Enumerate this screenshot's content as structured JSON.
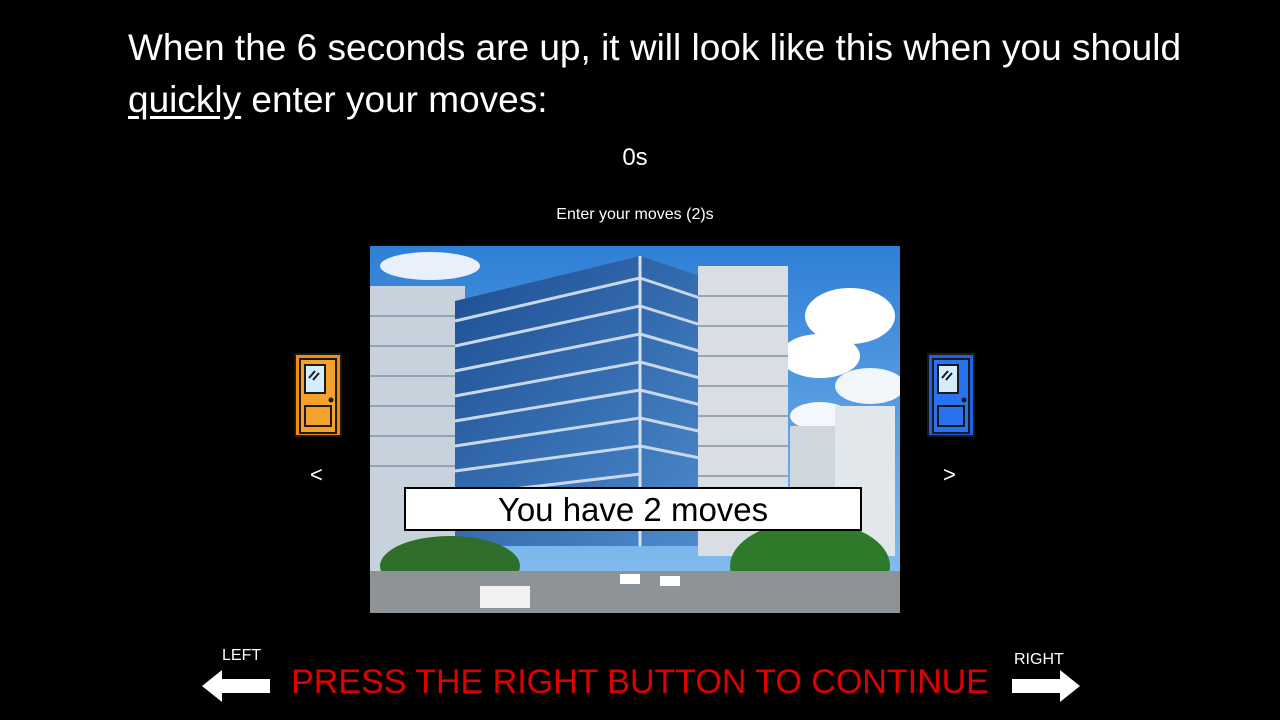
{
  "instruction": {
    "before": "When the 6 seconds are up, it will look like this when you should ",
    "emphasis": "quickly",
    "after": " enter your moves:"
  },
  "timer": "0s",
  "prompt": "Enter your moves (2)s",
  "scene_overlay": "You have 2 moves",
  "left_door": {
    "color": "#f08c0a",
    "icon": "door-icon"
  },
  "right_door": {
    "color": "#1f5fe0",
    "icon": "door-icon"
  },
  "left_chevron": "<",
  "right_chevron": ">",
  "left_label": "LEFT",
  "right_label": "RIGHT",
  "continue_text": "PRESS THE RIGHT BUTTON TO CONTINUE",
  "colors": {
    "continue": "#e00000",
    "background": "#000000"
  }
}
